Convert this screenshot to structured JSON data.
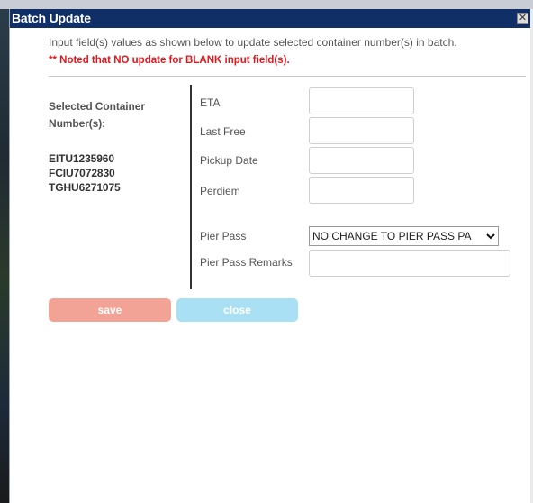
{
  "dialog": {
    "title": "Batch Update",
    "close_glyph": "✕",
    "instruction": "Input field(s) values as shown below to update selected container number(s) in batch.",
    "note": "** Noted that NO update for BLANK input field(s)."
  },
  "selected": {
    "label": "Selected Container Number(s):",
    "containers": [
      "EITU1235960",
      "FCIU7072830",
      "TGHU6271075"
    ]
  },
  "fields": {
    "eta": {
      "label": "ETA",
      "value": ""
    },
    "last_free": {
      "label": "Last Free",
      "value": ""
    },
    "pickup_date": {
      "label": "Pickup Date",
      "value": ""
    },
    "perdiem": {
      "label": "Perdiem",
      "value": ""
    },
    "pier_pass": {
      "label": "Pier Pass",
      "selected": "NO CHANGE TO PIER PASS PA"
    },
    "pier_pass_remarks": {
      "label": "Pier Pass Remarks",
      "value": ""
    }
  },
  "buttons": {
    "save": "save",
    "close": "close"
  },
  "colors": {
    "titlebar": "#0f2f66",
    "note": "#e0191f",
    "save_button": "#f3a395",
    "close_button": "#a9e0f3"
  }
}
